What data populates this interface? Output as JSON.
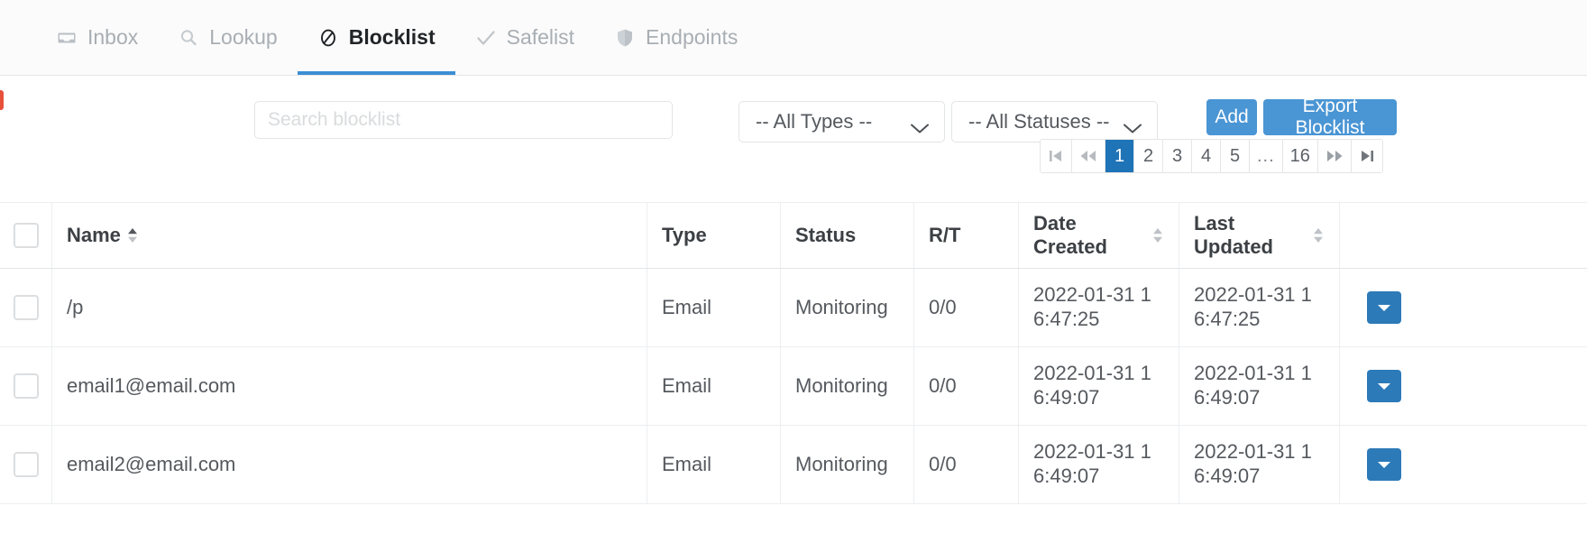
{
  "nav": {
    "tabs": [
      {
        "label": "Inbox",
        "icon": "inbox-icon",
        "active": false
      },
      {
        "label": "Lookup",
        "icon": "search-icon",
        "active": false
      },
      {
        "label": "Blocklist",
        "icon": "block-icon",
        "active": true
      },
      {
        "label": "Safelist",
        "icon": "check-icon",
        "active": false
      },
      {
        "label": "Endpoints",
        "icon": "shield-icon",
        "active": false
      }
    ]
  },
  "controls": {
    "search_placeholder": "Search blocklist",
    "search_value": "",
    "types_select": "-- All Types --",
    "statuses_select": "-- All Statuses --",
    "add_label": "Add",
    "export_label": "Export Blocklist"
  },
  "pagination": {
    "first_icon": "first-page-icon",
    "prev_icon": "prev-page-icon",
    "pages": [
      "1",
      "2",
      "3",
      "4",
      "5",
      "...",
      "16"
    ],
    "current": "1",
    "next_icon": "next-page-icon",
    "last_icon": "last-page-icon"
  },
  "table": {
    "headers": {
      "name": "Name",
      "type": "Type",
      "status": "Status",
      "rt": "R/T",
      "date_created": "Date Created",
      "last_updated": "Last Updated"
    },
    "rows": [
      {
        "name": "/p",
        "type": "Email",
        "status": "Monitoring",
        "rt": "0/0",
        "date_created": "2022-01-31 16:47:25",
        "last_updated": "2022-01-31 16:47:25"
      },
      {
        "name": "email1@email.com",
        "type": "Email",
        "status": "Monitoring",
        "rt": "0/0",
        "date_created": "2022-01-31 16:49:07",
        "last_updated": "2022-01-31 16:49:07"
      },
      {
        "name": "email2@email.com",
        "type": "Email",
        "status": "Monitoring",
        "rt": "0/0",
        "date_created": "2022-01-31 16:49:07",
        "last_updated": "2022-01-31 16:49:07"
      }
    ]
  },
  "colors": {
    "accent": "#4a95d4",
    "active_page": "#1f73b7",
    "tab_underline": "#3b8fd4",
    "row_action": "#2d7ab8",
    "marker": "#e8503a"
  }
}
